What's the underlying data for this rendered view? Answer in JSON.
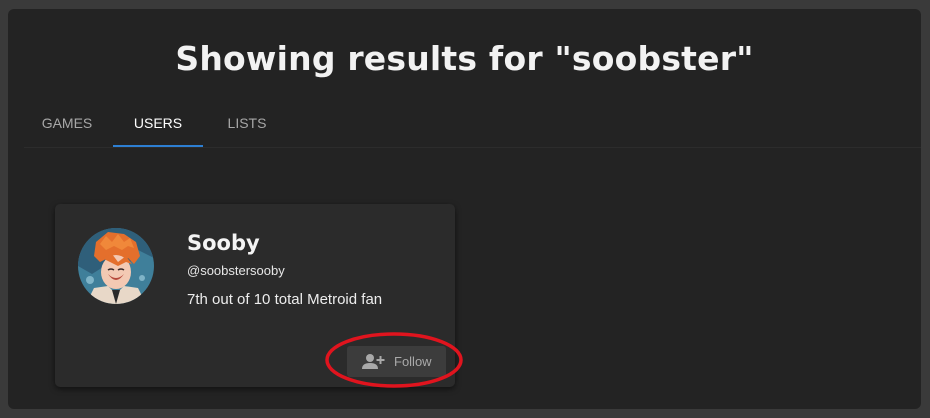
{
  "search": {
    "heading": "Showing results for \"soobster\""
  },
  "tabs": [
    {
      "label": "GAMES",
      "active": false
    },
    {
      "label": "USERS",
      "active": true
    },
    {
      "label": "LISTS",
      "active": false
    }
  ],
  "colors": {
    "accent": "#2d7fd3",
    "annotation": "#e0141e"
  },
  "user_card": {
    "name": "Sooby",
    "handle": "@soobstersooby",
    "bio": "7th out of 10 total Metroid fan",
    "follow_label": "Follow",
    "follow_icon": "person-add-icon"
  }
}
